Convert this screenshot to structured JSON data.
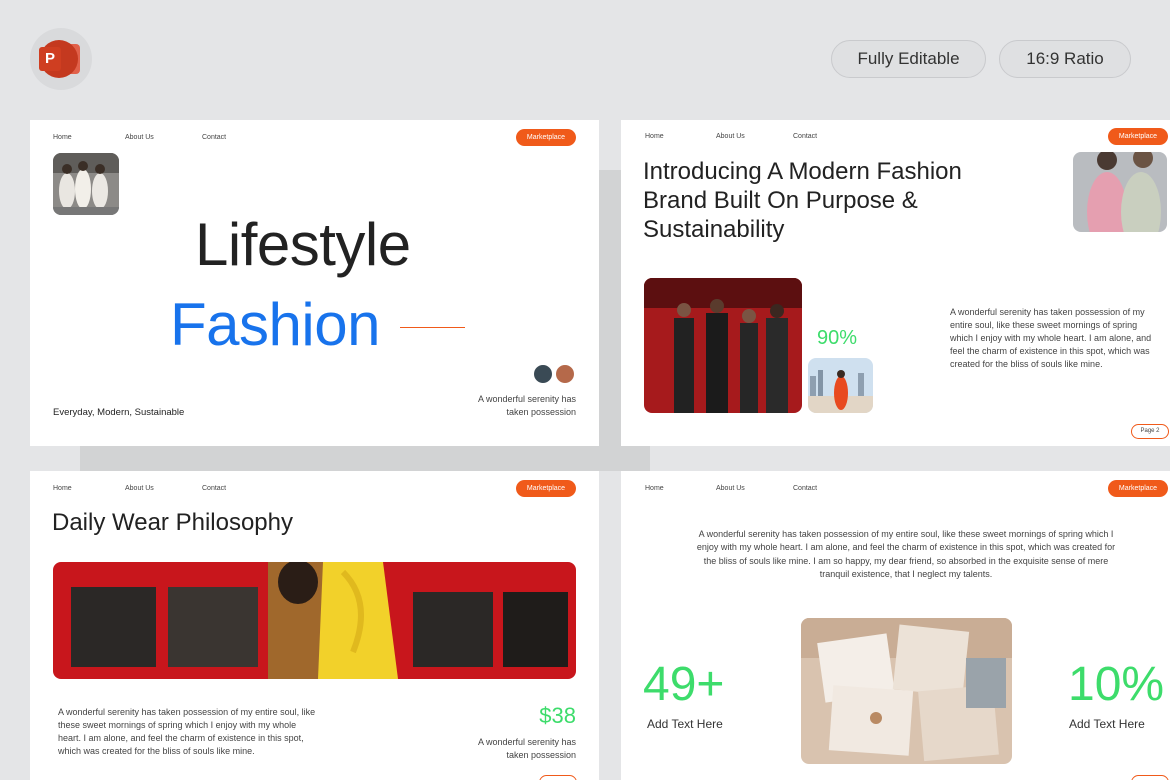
{
  "header": {
    "badges": [
      "Fully Editable",
      "16:9 Ratio"
    ]
  },
  "nav": {
    "home": "Home",
    "about": "About Us",
    "contact": "Contact",
    "marketplace": "Marketplace"
  },
  "slide1": {
    "title_line1": "Lifestyle",
    "title_line2": "Fashion",
    "tagline": "Everyday, Modern, Sustainable",
    "caption": "A wonderful serenity has taken possession"
  },
  "slide2": {
    "title": "Introducing A Modern Fashion Brand Built On Purpose & Sustainability",
    "percent": "90%",
    "paragraph": "A wonderful serenity has taken possession of my entire soul, like these sweet mornings of spring which I enjoy with my whole heart. I am alone, and feel the charm of existence in this spot, which was created for the bliss of souls like mine.",
    "page_label": "Page 2"
  },
  "slide3": {
    "title": "Daily Wear Philosophy",
    "paragraph": "A wonderful serenity has taken possession of my entire soul, like these sweet mornings of spring which I enjoy with my whole heart. I am alone, and feel the charm of existence in this spot, which was created for the bliss of souls like mine.",
    "price": "$38",
    "price_caption": "A wonderful serenity has taken possession"
  },
  "slide4": {
    "paragraph": "A wonderful serenity has taken possession of my entire soul, like these sweet mornings of spring which I enjoy with my whole heart. I am alone, and feel the charm of existence in this spot, which was created for the bliss of souls like mine. I am so happy, my dear friend, so absorbed in the exquisite sense of mere tranquil existence, that I neglect my talents.",
    "stat_left": "49+",
    "stat_left_label": "Add Text Here",
    "stat_right": "10%",
    "stat_right_label": "Add Text Here"
  },
  "colors": {
    "accent_orange": "#f05a1a",
    "accent_blue": "#1873ec",
    "accent_green": "#3ddc6b",
    "background": "#e4e5e7"
  }
}
